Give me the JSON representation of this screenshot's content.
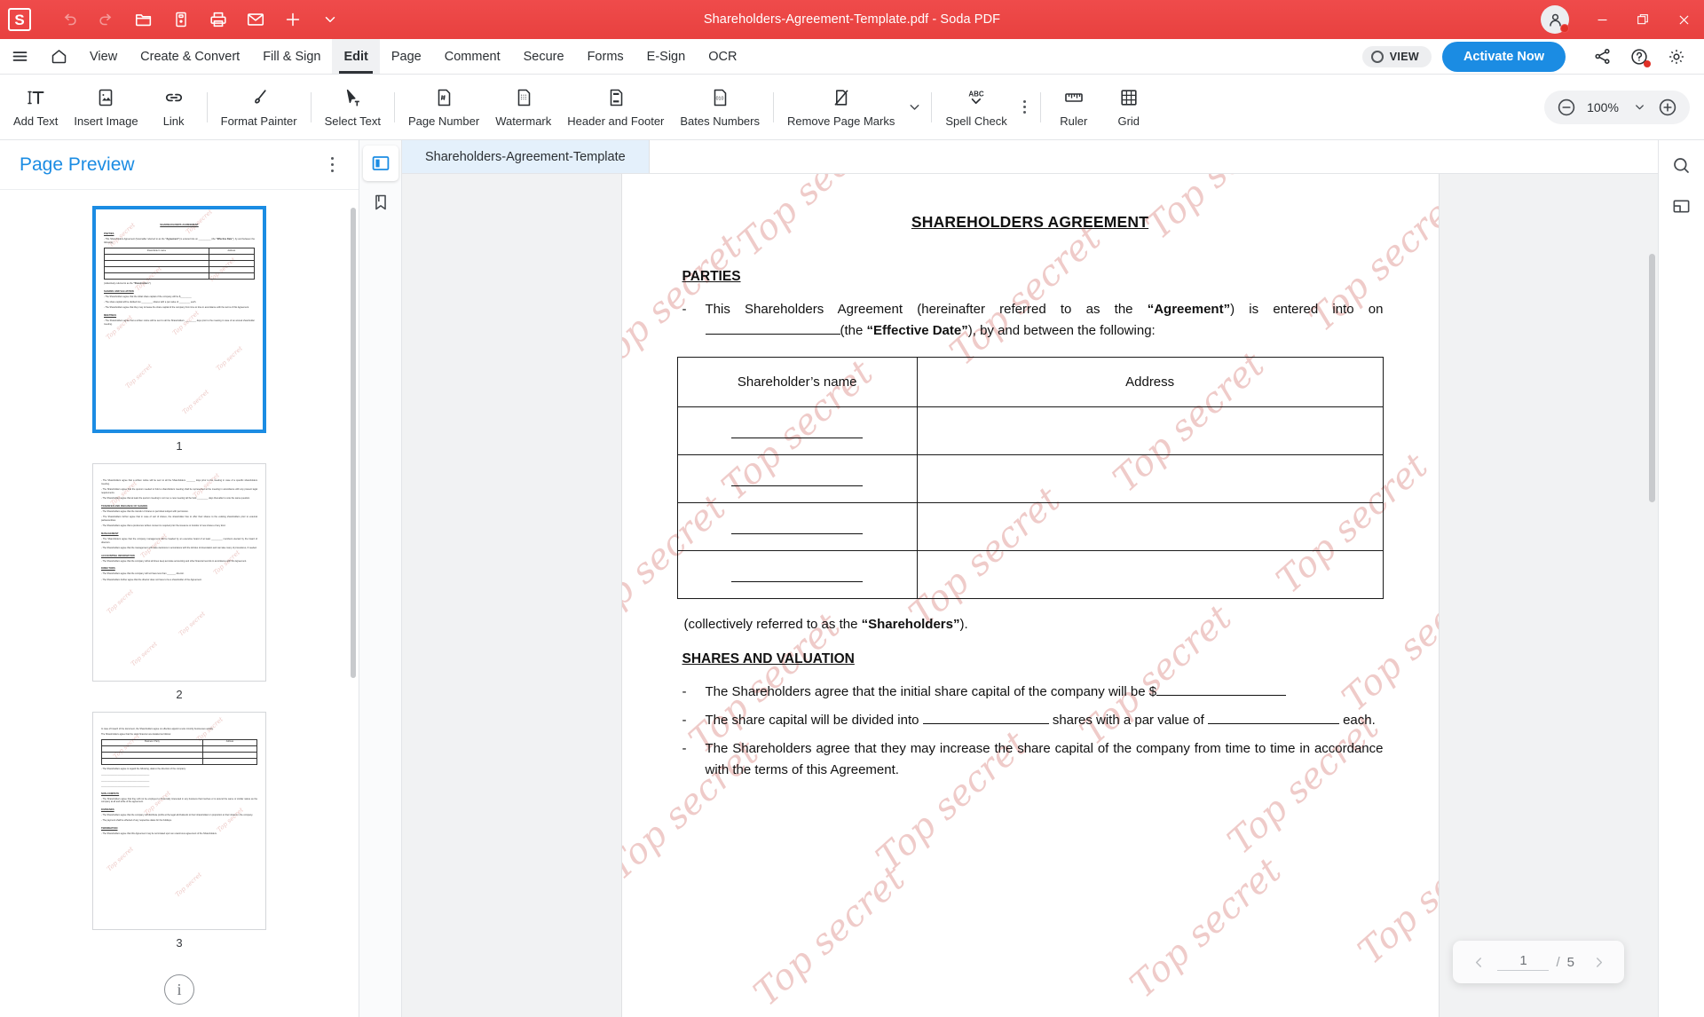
{
  "window": {
    "title": "Shareholders-Agreement-Template.pdf   -   Soda PDF",
    "logo": "S",
    "minimize_icon": "minimize-icon",
    "maximize_icon": "maximize-icon",
    "close_icon": "close-icon",
    "account_icon": "account-icon"
  },
  "quick_access": [
    {
      "name": "undo",
      "icon": "undo-icon",
      "label": "Undo"
    },
    {
      "name": "redo",
      "icon": "redo-icon",
      "label": "Redo"
    },
    {
      "name": "open",
      "icon": "folder-open-icon",
      "label": "Open"
    },
    {
      "name": "save",
      "icon": "save-icon",
      "label": "Save"
    },
    {
      "name": "print",
      "icon": "print-icon",
      "label": "Print"
    },
    {
      "name": "email",
      "icon": "envelope-icon",
      "label": "Email"
    },
    {
      "name": "new",
      "icon": "plus-icon",
      "label": "New"
    },
    {
      "name": "more",
      "icon": "chevron-down-icon",
      "label": "More"
    }
  ],
  "menubar": {
    "hamburger_icon": "hamburger-icon",
    "home_icon": "home-icon",
    "items": [
      {
        "label": "View",
        "active": false
      },
      {
        "label": "Create & Convert",
        "active": false
      },
      {
        "label": "Fill & Sign",
        "active": false
      },
      {
        "label": "Edit",
        "active": true
      },
      {
        "label": "Page",
        "active": false
      },
      {
        "label": "Comment",
        "active": false
      },
      {
        "label": "Secure",
        "active": false
      },
      {
        "label": "Forms",
        "active": false
      },
      {
        "label": "E-Sign",
        "active": false
      },
      {
        "label": "OCR",
        "active": false
      }
    ],
    "view_label": "VIEW",
    "activate_label": "Activate Now",
    "share_icon": "share-icon",
    "help_icon": "help-icon",
    "settings_icon": "gear-icon"
  },
  "ribbon": {
    "tools": [
      {
        "label": "Add Text",
        "icon": "add-text-icon"
      },
      {
        "label": "Insert Image",
        "icon": "insert-image-icon"
      },
      {
        "label": "Link",
        "icon": "link-icon"
      },
      {
        "label": "Format Painter",
        "icon": "format-painter-icon"
      },
      {
        "label": "Select Text",
        "icon": "select-text-icon"
      },
      {
        "label": "Page Number",
        "icon": "page-number-icon"
      },
      {
        "label": "Watermark",
        "icon": "watermark-icon"
      },
      {
        "label": "Header and Footer",
        "icon": "header-footer-icon"
      },
      {
        "label": "Bates Numbers",
        "icon": "bates-numbers-icon"
      },
      {
        "label": "Remove Page Marks",
        "icon": "remove-page-marks-icon"
      },
      {
        "label": "Spell Check",
        "icon": "spell-check-icon"
      },
      {
        "label": "Ruler",
        "icon": "ruler-icon"
      },
      {
        "label": "Grid",
        "icon": "grid-icon"
      }
    ],
    "overflow_caret": "chevron-down-icon",
    "overflow_dots": "more-vertical-icon"
  },
  "zoom": {
    "minus_icon": "zoom-out-icon",
    "plus_icon": "zoom-in-icon",
    "caret_icon": "chevron-down-icon",
    "value": "100%"
  },
  "sidebar": {
    "title": "Page Preview",
    "kebab_icon": "more-vertical-icon",
    "info_icon": "info-icon",
    "thumbnails": [
      {
        "number": "1",
        "selected": true
      },
      {
        "number": "2",
        "selected": false
      },
      {
        "number": "3",
        "selected": false
      }
    ]
  },
  "doc_rail": [
    {
      "name": "page-preview-panel",
      "icon": "panel-left-icon",
      "active": true
    },
    {
      "name": "bookmarks-panel",
      "icon": "bookmark-icon",
      "active": false
    }
  ],
  "right_rail": [
    {
      "name": "search",
      "icon": "search-icon"
    },
    {
      "name": "view-mode",
      "icon": "view-mode-icon"
    }
  ],
  "tabs": [
    {
      "label": "Shareholders-Agreement-Template",
      "active": true
    }
  ],
  "page_nav": {
    "prev_icon": "chevron-left-icon",
    "next_icon": "chevron-right-icon",
    "current": "1",
    "separator": "/",
    "total": "5"
  },
  "document": {
    "watermark_text": "Top secret",
    "title": "SHAREHOLDERS AGREEMENT",
    "section_parties": "PARTIES",
    "parties_bullet_dash": "-",
    "parties_p1_a": "This Shareholders Agreement (hereinafter referred to as the ",
    "parties_p1_b": "“Agreement”",
    "parties_p1_c": ") is entered into on ",
    "parties_p1_d": "(the ",
    "parties_p1_e": "“Effective Date”",
    "parties_p1_f": "), by and between the following:",
    "table_headers": [
      "Shareholder’s name",
      "Address"
    ],
    "table_rows": [
      {
        "name": "",
        "address": ""
      },
      {
        "name": "",
        "address": ""
      },
      {
        "name": "",
        "address": ""
      },
      {
        "name": "",
        "address": ""
      }
    ],
    "collectively_a": "(collectively referred to as the ",
    "collectively_b": "“Shareholders”",
    "collectively_c": ").",
    "section_shares": "SHARES AND VALUATION",
    "shares_b1_a": "The Shareholders agree that the initial share capital of the company will be",
    "shares_b1_b": "$",
    "shares_b2_a": "The share capital will be divided into",
    "shares_b2_b": "shares with a par value of",
    "shares_b2_c": "each.",
    "shares_b3": "The Shareholders agree that they may increase the share capital of the company from time to time in accordance with the terms of this Agreement."
  },
  "colors": {
    "titlebar_red": "#ef4b4b",
    "accent_blue": "#1b8ce3",
    "watermark_pink": "#e9b8b5",
    "sidebar_title": "#1b8ce3"
  }
}
